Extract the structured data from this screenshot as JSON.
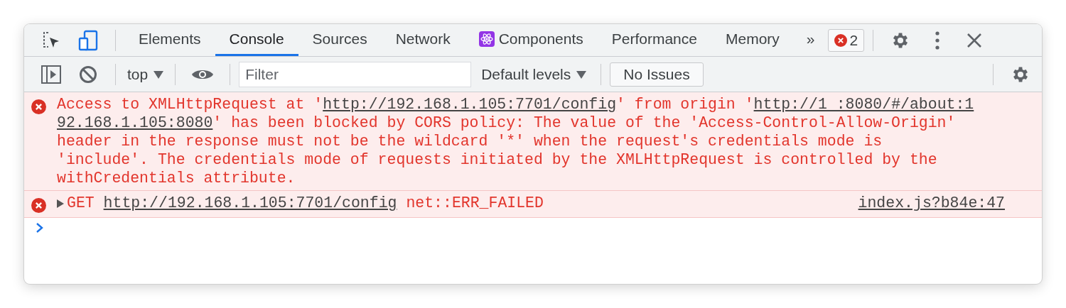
{
  "tab_bar": {
    "tabs": [
      {
        "label": "Elements",
        "selected": false,
        "kind": "plain"
      },
      {
        "label": "Console",
        "selected": true,
        "kind": "plain"
      },
      {
        "label": "Sources",
        "selected": false,
        "kind": "plain"
      },
      {
        "label": "Network",
        "selected": false,
        "kind": "plain"
      },
      {
        "label": "Components",
        "selected": false,
        "kind": "extension"
      },
      {
        "label": "Performance",
        "selected": false,
        "kind": "plain"
      },
      {
        "label": "Memory",
        "selected": false,
        "kind": "plain"
      }
    ],
    "more": "»",
    "error_count": "2"
  },
  "toolbar": {
    "context": "top",
    "filter": {
      "placeholder": "Filter"
    },
    "levels": "Default levels",
    "issues": "No Issues"
  },
  "messages": [
    {
      "lines": [
        [
          {
            "kind": "text",
            "text": "Access to XMLHttpRequest at '"
          },
          {
            "kind": "link",
            "text": "http://192.168.1.105:7701/config"
          },
          {
            "kind": "text",
            "text": "' from origin '"
          },
          {
            "kind": "link",
            "text": "http://1 :8080/#/about:1"
          }
        ],
        [
          {
            "kind": "link",
            "text": "92.168.1.105:8080"
          },
          {
            "kind": "text",
            "text": "' has been blocked by CORS policy: The value of the 'Access-Control-Allow-Origin'"
          }
        ],
        [
          {
            "kind": "text",
            "text": "header in the response must not be the wildcard '*' when the request's credentials mode is"
          }
        ],
        [
          {
            "kind": "text",
            "text": "'include'. The credentials mode of requests initiated by the XMLHttpRequest is controlled by the"
          }
        ],
        [
          {
            "kind": "text",
            "text": "withCredentials attribute."
          }
        ]
      ]
    },
    {
      "expanded": false,
      "lines": [
        [
          {
            "kind": "text",
            "text": "GET "
          },
          {
            "kind": "link",
            "text": "http://192.168.1.105:7701/config"
          },
          {
            "kind": "text",
            "text": " net::ERR_FAILED"
          }
        ]
      ],
      "source": "index.js?b84e:47"
    }
  ]
}
